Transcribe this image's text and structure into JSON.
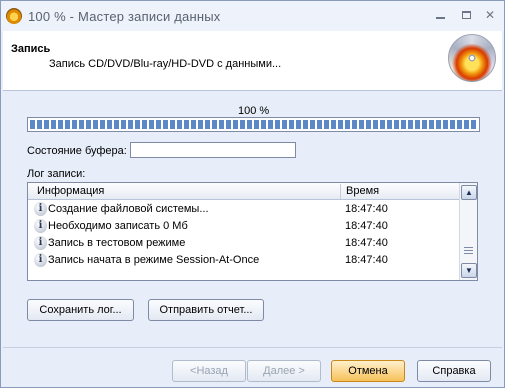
{
  "window": {
    "title": "100 % - Мастер записи данных",
    "icon": "nero-flame-icon"
  },
  "header": {
    "title": "Запись",
    "subtitle": "Запись CD/DVD/Blu-ray/HD-DVD с данными...",
    "icon": "burning-disc-icon"
  },
  "progress": {
    "label": "100 %",
    "value": 1.0
  },
  "buffer": {
    "label": "Состояние буфера:",
    "value": ""
  },
  "log": {
    "label": "Лог записи:",
    "columns": [
      "Информация",
      "Время"
    ],
    "rows": [
      {
        "info": "Создание файловой системы...",
        "time": "18:47:40"
      },
      {
        "info": "Необходимо записать 0 Мб",
        "time": "18:47:40"
      },
      {
        "info": "Запись в тестовом режиме",
        "time": "18:47:40"
      },
      {
        "info": "Запись начата в режиме Session-At-Once",
        "time": "18:47:40"
      }
    ]
  },
  "actions": {
    "save_log": "Сохранить лог...",
    "send_report": "Отправить отчет..."
  },
  "footer": {
    "back": "<Назад",
    "next": "Далее >",
    "cancel": "Отмена",
    "help": "Справка"
  },
  "colors": {
    "accent": "#f7c15a",
    "progress": "#5c88c8",
    "background": "#e7eef9"
  }
}
